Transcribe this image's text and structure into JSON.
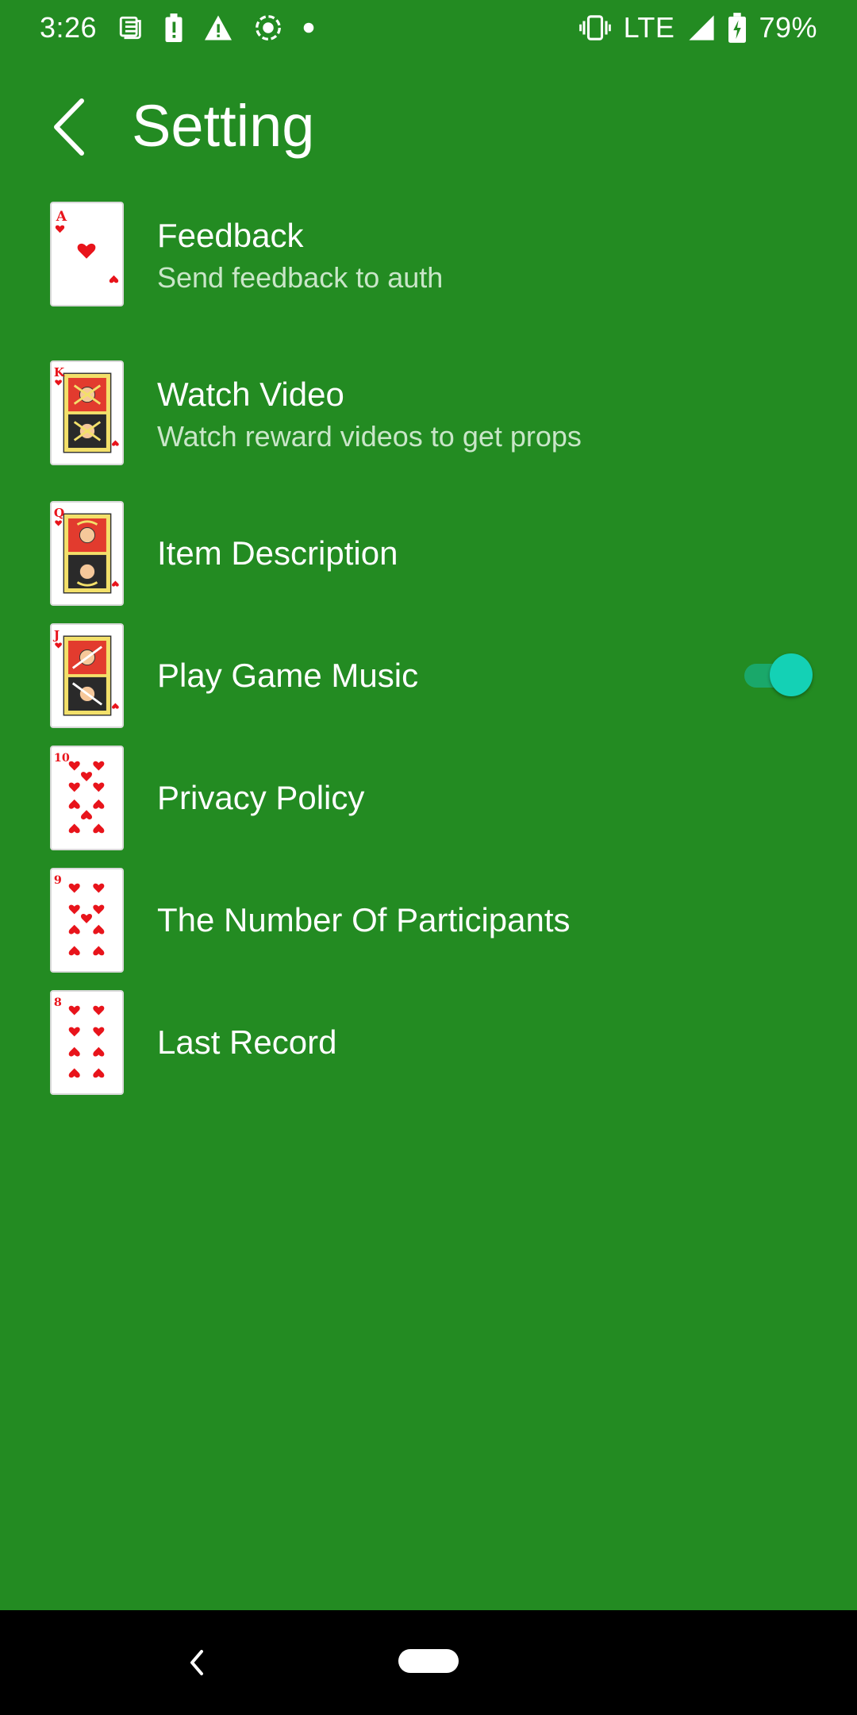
{
  "status_bar": {
    "time": "3:26",
    "network": "LTE",
    "battery": "79%",
    "left_icons": [
      "news-icon",
      "battery-alert-icon",
      "warning-icon",
      "screen-record-icon",
      "dot-icon"
    ],
    "right_icons": [
      "vibrate-icon",
      "signal-icon",
      "battery-charging-icon"
    ]
  },
  "header": {
    "title": "Setting",
    "back_icon": "chevron-left-icon"
  },
  "settings": {
    "items": [
      {
        "title": "Feedback",
        "subtitle": "Send feedback to auth",
        "card": "ace-of-hearts"
      },
      {
        "title": "Watch Video",
        "subtitle": "Watch reward videos to get props",
        "card": "king-of-hearts"
      },
      {
        "title": "Item Description",
        "card": "queen-of-hearts"
      },
      {
        "title": "Play Game Music",
        "card": "jack-of-hearts",
        "toggle": true
      },
      {
        "title": "Privacy Policy",
        "card": "ten-of-hearts"
      },
      {
        "title": "The Number Of Participants",
        "card": "nine-of-hearts"
      },
      {
        "title": "Last Record",
        "card": "eight-of-hearts"
      }
    ]
  },
  "cards": {
    "ace": "A",
    "king": "K",
    "queen": "Q",
    "jack": "J",
    "ten": "10",
    "nine": "9",
    "eight": "8"
  },
  "colors": {
    "background": "#238b22",
    "suit_red": "#e8141b",
    "toggle_thumb": "#14d1b5",
    "toggle_track": "#1aa86a",
    "subtitle": "#c9e6c8"
  },
  "nav_bar": {
    "back_icon": "nav-back-icon",
    "home_icon": "home-pill-icon"
  }
}
